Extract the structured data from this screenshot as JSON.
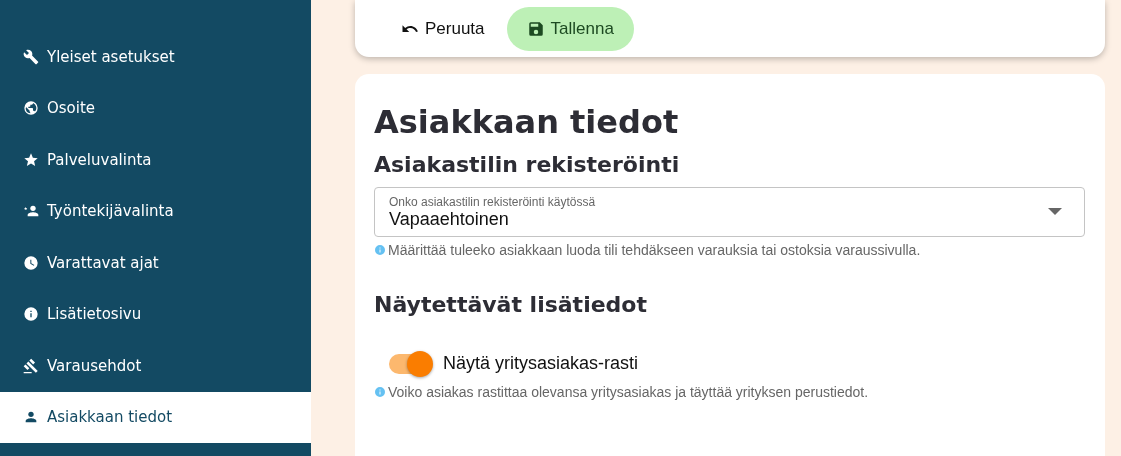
{
  "sidebar": {
    "items": [
      {
        "label": "Yleiset asetukset",
        "selected": false
      },
      {
        "label": "Osoite",
        "selected": false
      },
      {
        "label": "Palveluvalinta",
        "selected": false
      },
      {
        "label": "Työntekijävalinta",
        "selected": false
      },
      {
        "label": "Varattavat ajat",
        "selected": false
      },
      {
        "label": "Lisätietosivu",
        "selected": false
      },
      {
        "label": "Varausehdot",
        "selected": false
      },
      {
        "label": "Asiakkaan tiedot",
        "selected": true
      }
    ]
  },
  "toolbar": {
    "cancel": "Peruuta",
    "save": "Tallenna"
  },
  "content": {
    "title": "Asiakkaan tiedot",
    "registration": {
      "heading": "Asiakastilin rekisteröinti",
      "select": {
        "label": "Onko asiakastilin rekisteröinti käytössä",
        "value": "Vapaaehtoinen"
      },
      "hint": "Määrittää tuleeko asiakkaan luoda tili tehdäkseen varauksia tai ostoksia varaussivulla."
    },
    "extra": {
      "heading": "Näytettävät lisätiedot",
      "toggle": {
        "label": "Näytä yritysasiakas-rasti",
        "on": true
      },
      "hint": "Voiko asiakas rastittaa olevansa yritysasiakas ja täyttää yrityksen perustiedot."
    }
  }
}
